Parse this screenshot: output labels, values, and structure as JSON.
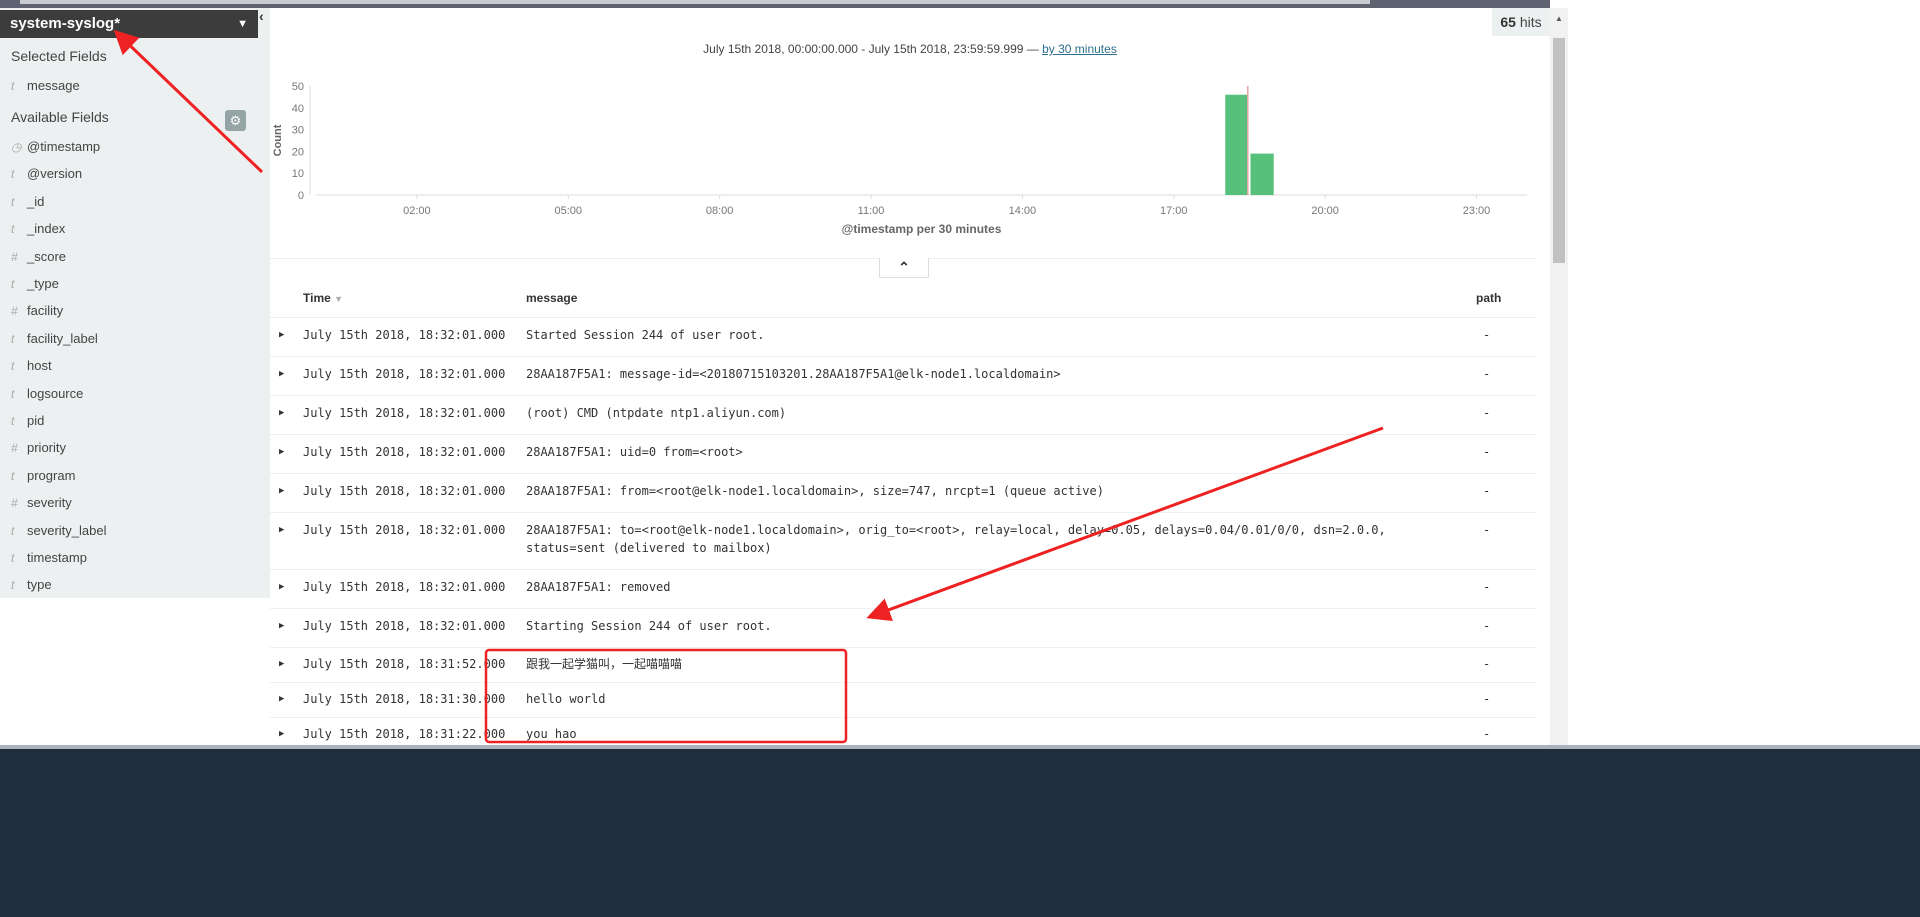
{
  "sidebar": {
    "index_pattern": "system-syslog*",
    "selected_title": "Selected Fields",
    "selected_fields": [
      {
        "type": "t",
        "name": "message"
      }
    ],
    "available_title": "Available Fields",
    "available_fields": [
      {
        "type": "clock",
        "name": "@timestamp"
      },
      {
        "type": "t",
        "name": "@version"
      },
      {
        "type": "t",
        "name": "_id"
      },
      {
        "type": "t",
        "name": "_index"
      },
      {
        "type": "#",
        "name": "_score"
      },
      {
        "type": "t",
        "name": "_type"
      },
      {
        "type": "#",
        "name": "facility"
      },
      {
        "type": "t",
        "name": "facility_label"
      },
      {
        "type": "t",
        "name": "host"
      },
      {
        "type": "t",
        "name": "logsource"
      },
      {
        "type": "t",
        "name": "pid"
      },
      {
        "type": "#",
        "name": "priority"
      },
      {
        "type": "t",
        "name": "program"
      },
      {
        "type": "#",
        "name": "severity"
      },
      {
        "type": "t",
        "name": "severity_label"
      },
      {
        "type": "t",
        "name": "timestamp"
      },
      {
        "type": "t",
        "name": "type"
      }
    ]
  },
  "hits": {
    "count": "65",
    "label": "hits"
  },
  "range": {
    "text": "July 15th 2018, 00:00:00.000 - July 15th 2018, 23:59:59.999 —",
    "interval_link": "by 30 minutes"
  },
  "chart_data": {
    "type": "bar",
    "ylabel": "Count",
    "xlabel": "@timestamp per 30 minutes",
    "ylim": [
      0,
      50
    ],
    "yticks": [
      0,
      10,
      20,
      30,
      40,
      50
    ],
    "xlim_hours": [
      0,
      24
    ],
    "xticks": [
      "02:00",
      "05:00",
      "08:00",
      "11:00",
      "14:00",
      "17:00",
      "20:00",
      "23:00"
    ],
    "bars": [
      {
        "x": "18:00",
        "value": 46
      },
      {
        "x": "18:30",
        "value": 19
      }
    ],
    "current_time_marker": "18:28",
    "bar_color": "#57c17b",
    "marker_color": "#e7a4a4",
    "grid": false
  },
  "table": {
    "headers": {
      "time": "Time",
      "message": "message",
      "path": "path"
    },
    "rows": [
      {
        "time": "July 15th 2018, 18:32:01.000",
        "message": "Started Session 244 of user root.",
        "path": "-"
      },
      {
        "time": "July 15th 2018, 18:32:01.000",
        "message": "28AA187F5A1: message-id=<20180715103201.28AA187F5A1@elk-node1.localdomain>",
        "path": "-"
      },
      {
        "time": "July 15th 2018, 18:32:01.000",
        "message": "(root) CMD (ntpdate ntp1.aliyun.com)",
        "path": "-"
      },
      {
        "time": "July 15th 2018, 18:32:01.000",
        "message": "28AA187F5A1: uid=0 from=<root>",
        "path": "-"
      },
      {
        "time": "July 15th 2018, 18:32:01.000",
        "message": "28AA187F5A1: from=<root@elk-node1.localdomain>, size=747, nrcpt=1 (queue active)",
        "path": "-"
      },
      {
        "time": "July 15th 2018, 18:32:01.000",
        "message": "28AA187F5A1: to=<root@elk-node1.localdomain>, orig_to=<root>, relay=local, delay=0.05, delays=0.04/0.01/0/0, dsn=2.0.0, status=sent (delivered to mailbox)",
        "path": "-"
      },
      {
        "time": "July 15th 2018, 18:32:01.000",
        "message": "28AA187F5A1: removed",
        "path": "-"
      },
      {
        "time": "July 15th 2018, 18:32:01.000",
        "message": "Starting Session 244 of user root.",
        "path": "-"
      },
      {
        "time": "July 15th 2018, 18:31:52.000",
        "message": "跟我一起学猫叫，一起喵喵喵",
        "path": "-"
      },
      {
        "time": "July 15th 2018, 18:31:30.000",
        "message": "hello world",
        "path": "-"
      },
      {
        "time": "July 15th 2018, 18:31:22.000",
        "message": "you hao",
        "path": "-"
      }
    ]
  },
  "annotation_color": "#ee2222"
}
